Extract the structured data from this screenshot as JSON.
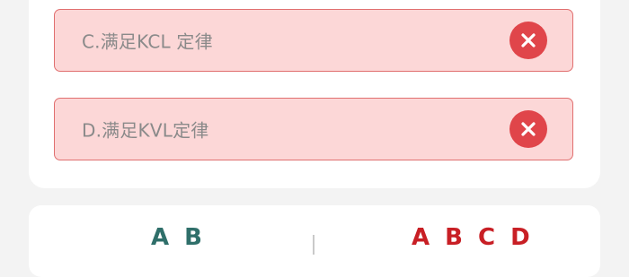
{
  "options": [
    {
      "text": "C.满足KCL 定律",
      "status": "wrong",
      "icon": "close-icon"
    },
    {
      "text": "D.满足KVL定律",
      "status": "wrong",
      "icon": "close-icon"
    }
  ],
  "answers": {
    "user_answer": "A B",
    "correct_answer": "A B C D"
  },
  "colors": {
    "option_bg": "#fcd7d7",
    "option_border": "#e06f6f",
    "wrong_icon": "#e0454a",
    "user_answer": "#2f6f6a",
    "correct_answer": "#c81f25"
  }
}
